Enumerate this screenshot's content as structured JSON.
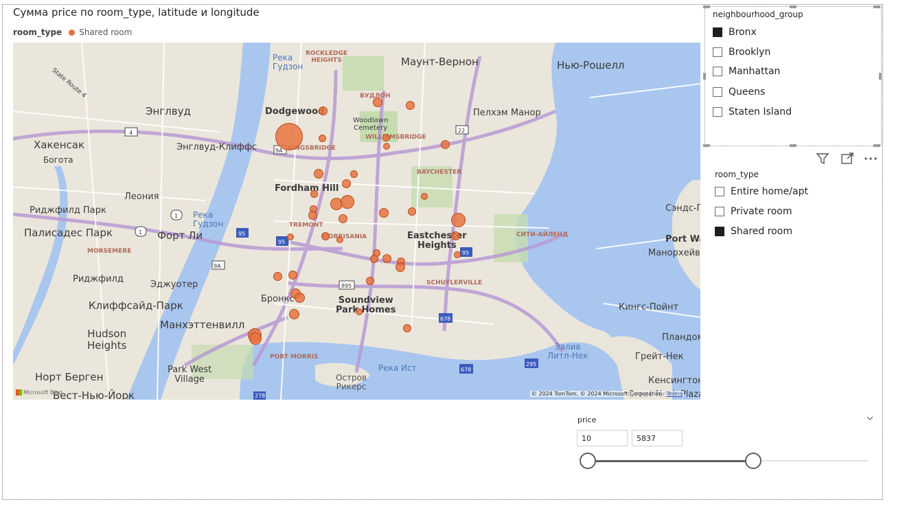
{
  "visual": {
    "title": "Сумма price по room_type, latitude и longitude",
    "legend_title": "room_type",
    "legend_item": "Shared room",
    "legend_color": "#e8703a"
  },
  "map": {
    "attribution": "© 2024 TomTom, © 2024 Microsoft Corporation",
    "terms": "Terms",
    "provider": "Microsoft Bing",
    "labels": {
      "river_hudson_1": "Река\nГудзон",
      "rockledge": "ROCKLEDGE\nHEIGHTS",
      "mount_vernon": "Маунт-Вернон",
      "new_rochelle": "Нью-Рошелл",
      "state_route": "State Route 4",
      "englewood": "Энглвуд",
      "dodgewood": "Dodgewood",
      "woodlawn": "Woodlawn\nCemetery",
      "williamsbridge": "WILLIAMSBRIDGE",
      "pelham_manor": "Пелхэм Манор",
      "wakefield": "ВУДЛОН",
      "hackensack": "Хакенсак",
      "bogota": "Богота",
      "englewood_cliffs": "Энглвуд-Клиффс",
      "kingsbridge": "KINGSBRIDGE",
      "baychester": "BAYCHESTER",
      "fordham_hill": "Fordham Hill",
      "leonia": "Леония",
      "ridgefield_park": "Риджфилд Парк",
      "river_hudson_2": "Река\nГудзон",
      "palisades_park": "Палисадес Парк",
      "fort_lee": "Форт Ли",
      "tremont": "TREMONT",
      "morrisania": "MORRISANIA",
      "eastchester": "Eastchester\nHeights",
      "city_island": "СИТИ-АЙЛЕНД",
      "sands_point": "Сэндс-Пойнт",
      "port_washington": "Port Was",
      "manorhaven": "Манорхейв",
      "morsemere": "MORSEMERE",
      "ridgefield": "Риджфилд",
      "edgewater": "Эджуотер",
      "schuylerville": "SCHUYLERVILLE",
      "bronx": "Бронкс",
      "soundview": "Soundview\nPark Homes",
      "cliffside_park": "Клиффсайд-Парк",
      "manhattanville": "Манхэттенвилл",
      "hudson_heights": "Hudson\nHeights",
      "kings_point": "Кингс-Пойнт",
      "plandome": "Пландом",
      "great_neck_rus": "Грейт-Нек",
      "liitle_neck_bay": "Залив\nЛитл-Нек",
      "kensington": "Кенсингтон",
      "great_neck_plaza": "Great Neck Plaza",
      "north_bergen": "Норт Берген",
      "park_west": "Park West\nVillage",
      "port_morris": "PORT MORRIS",
      "rikers": "Остров\nРикерс",
      "east_river": "Река Ист",
      "west_new_york": "Вест-Нью-Йорк"
    }
  },
  "slicers": {
    "neighbourhood": {
      "title": "neighbourhood_group",
      "items": [
        {
          "label": "Bronx",
          "checked": true
        },
        {
          "label": "Brooklyn",
          "checked": false
        },
        {
          "label": "Manhattan",
          "checked": false
        },
        {
          "label": "Queens",
          "checked": false
        },
        {
          "label": "Staten Island",
          "checked": false
        }
      ]
    },
    "room_type": {
      "title": "room_type",
      "items": [
        {
          "label": "Entire home/apt",
          "checked": false
        },
        {
          "label": "Private room",
          "checked": false
        },
        {
          "label": "Shared room",
          "checked": true
        }
      ]
    },
    "price": {
      "title": "price",
      "min_value": "10",
      "max_value": "5837",
      "range_fraction_start": 0,
      "range_fraction_end": 0.59
    }
  },
  "toolbar": {
    "icons": [
      "filter-icon",
      "focus-mode-icon",
      "more-options-icon"
    ]
  }
}
